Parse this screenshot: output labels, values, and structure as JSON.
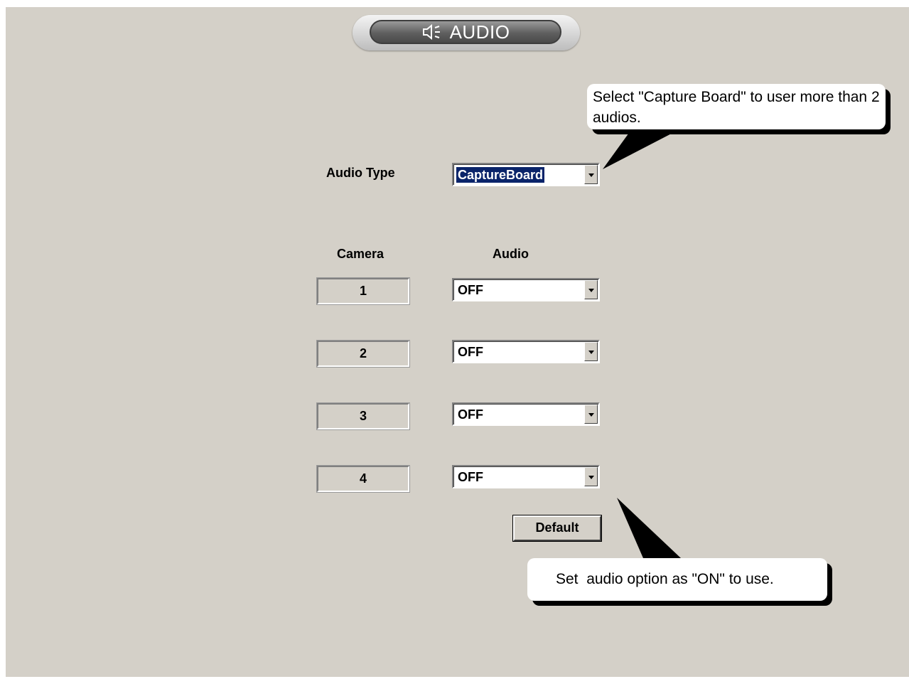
{
  "header": {
    "title": "AUDIO",
    "icon": "speaker-icon"
  },
  "audio_type": {
    "label": "Audio Type",
    "value": "CaptureBoard"
  },
  "table": {
    "camera_header": "Camera",
    "audio_header": "Audio",
    "rows": [
      {
        "camera": "1",
        "audio": "OFF"
      },
      {
        "camera": "2",
        "audio": "OFF"
      },
      {
        "camera": "3",
        "audio": "OFF"
      },
      {
        "camera": "4",
        "audio": "OFF"
      }
    ]
  },
  "default_button": "Default",
  "callouts": {
    "top": "Select \"Capture Board\" to user more than 2 audios.",
    "bottom": "Set  audio option as \"ON\" to use."
  },
  "colors": {
    "panel": "#d4d0c8",
    "selection": "#0a246a"
  }
}
